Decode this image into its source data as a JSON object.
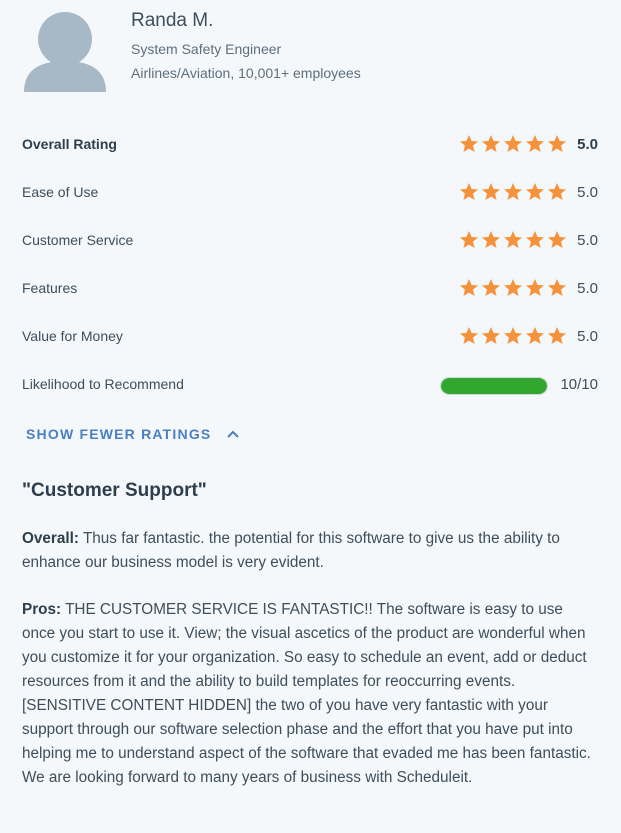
{
  "reviewer": {
    "name": "Randa M.",
    "title": "System Safety Engineer",
    "company": "Airlines/Aviation, 10,001+ employees"
  },
  "ratings": [
    {
      "label": "Overall Rating",
      "value": "5.0",
      "stars": 5
    },
    {
      "label": "Ease of Use",
      "value": "5.0",
      "stars": 5
    },
    {
      "label": "Customer Service",
      "value": "5.0",
      "stars": 5
    },
    {
      "label": "Features",
      "value": "5.0",
      "stars": 5
    },
    {
      "label": "Value for Money",
      "value": "5.0",
      "stars": 5
    }
  ],
  "recommend": {
    "label": "Likelihood to Recommend",
    "value": "10/10",
    "fraction": 1.0
  },
  "toggle_label": "SHOW FEWER RATINGS",
  "review": {
    "title": "\"Customer Support\"",
    "overall_label": "Overall:",
    "overall_text": " Thus far fantastic. the potential for this software to give us the ability to enhance our business model is very evident.",
    "pros_label": "Pros:",
    "pros_text": " THE CUSTOMER SERVICE IS FANTASTIC!! The software is easy to use once you start to use it. View; the visual ascetics of the product are wonderful when you customize it for your organization. So easy to schedule an event, add or deduct resources from it and the ability to build templates for reoccurring events. [SENSITIVE CONTENT HIDDEN] the two of you have very fantastic with your support through our software selection phase and the effort that you have put into helping me to understand aspect of the software that evaded me has been fantastic. We are looking forward to many years of business with Scheduleit."
  },
  "colors": {
    "star": "#f5923a",
    "bar": "#32a72f",
    "link": "#4a7fc1",
    "avatar": "#a7b9c6"
  },
  "icons": {
    "avatar": "user-avatar-icon",
    "star": "star-icon",
    "toggle": "chevron-up-icon"
  }
}
